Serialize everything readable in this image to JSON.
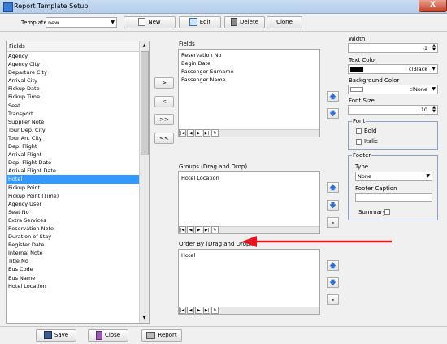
{
  "window": {
    "title": "Report Template Setup",
    "close_glyph": "X"
  },
  "toolbar": {
    "template_label": "Template",
    "template_value": "new",
    "new_label": "New",
    "edit_label": "Edit",
    "delete_label": "Delete",
    "clone_label": "Clone"
  },
  "fields_list": {
    "header": "Fields",
    "items": [
      "Agency",
      "Agency City",
      "Departure City",
      "Arrival City",
      "Pickup Date",
      "Pickup Time",
      "Seat",
      "Transport",
      "Supplier Note",
      "Tour Dep. City",
      "Tour Arr. City",
      "Dep. Flight",
      "Arrival Flight",
      "Dep. Flight Date",
      "Arrival Flight Date",
      "Hotel",
      "Pickup Point",
      "Pickup Point (Time)",
      "Agency User",
      "Seat No",
      "Extra Services",
      "Reservation Note",
      "Duration of Stay",
      "Register Date",
      "Internal Note",
      "Title No",
      "Bus Code",
      "Bus Name",
      "Hotel Location"
    ],
    "selected": "Hotel"
  },
  "transfer_buttons": {
    "add": ">",
    "remove": "<",
    "add_all": ">>",
    "remove_all": "<<"
  },
  "selected_fields": {
    "label": "Fields",
    "items": [
      "Reservation No",
      "Begin Date",
      "Passenger Surname",
      "Passenger Name"
    ]
  },
  "groups": {
    "label": "Groups (Drag and Drop)",
    "items": [
      "Hotel Location"
    ]
  },
  "order_by": {
    "label": "Order By (Drag and Drop)",
    "items": [
      "Hotel"
    ]
  },
  "navigator": [
    "|◀",
    "◀",
    "▶",
    "▶|",
    "↻"
  ],
  "minus_label": "-",
  "properties": {
    "width_label": "Width",
    "width_value": "-1",
    "text_color_label": "Text Color",
    "text_color_value": "clBlack",
    "text_color_swatch": "#000000",
    "bg_color_label": "Background Color",
    "bg_color_value": "clNone",
    "bg_color_swatch": "#ffffff",
    "font_size_label": "Font Size",
    "font_size_value": "10",
    "font_group_label": "Font",
    "bold_label": "Bold",
    "italic_label": "Italic",
    "footer_group_label": "Footer",
    "type_label": "Type",
    "type_value": "None",
    "footer_caption_label": "Footer Caption",
    "footer_caption_value": "",
    "summary_label": "Summary"
  },
  "bottom": {
    "save_label": "Save",
    "close_label": "Close",
    "report_label": "Report"
  },
  "colors": {
    "accent": "#3399ff",
    "annotation_arrow": "#e8141b"
  }
}
